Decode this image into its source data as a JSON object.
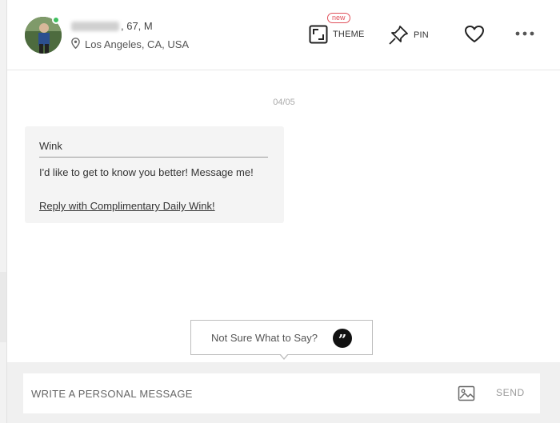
{
  "profile": {
    "name_suffix": ", 67, M",
    "location": "Los Angeles, CA, USA"
  },
  "header": {
    "new_badge": "new",
    "theme_label": "THEME",
    "pin_label": "PIN"
  },
  "chat": {
    "date": "04/05",
    "wink_title": "Wink",
    "wink_message": "I'd like to get to know you better! Message me!",
    "reply_link": "Reply with Complimentary Daily Wink!"
  },
  "suggestion": {
    "label": "Not Sure What to Say?",
    "quote_glyph": "”"
  },
  "composer": {
    "placeholder": "WRITE A PERSONAL MESSAGE",
    "send_label": "SEND"
  },
  "colors": {
    "online": "#3fbf5f",
    "new_badge": "#e0505a",
    "bubble_bg": "#f4f4f4"
  },
  "icons": [
    "location-pin-icon",
    "theme-icon",
    "pin-icon",
    "heart-icon",
    "more-icon",
    "quote-icon",
    "image-icon"
  ]
}
